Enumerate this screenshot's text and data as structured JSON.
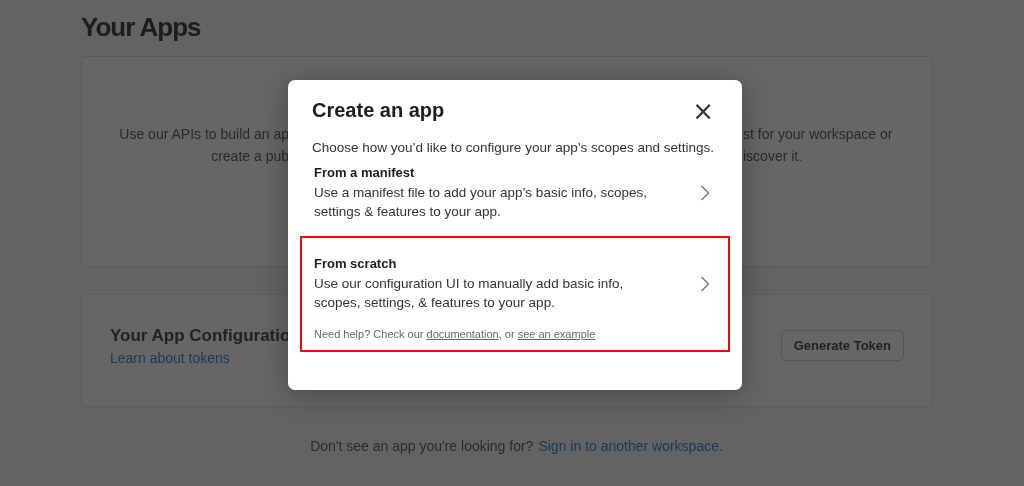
{
  "page": {
    "title": "Your Apps",
    "intro_card": {
      "left_lines": [
        "Use our APIs to build an ap",
        "create a pub"
      ],
      "right_lines": [
        "st for your workspace or",
        "iscover it."
      ]
    },
    "config_card": {
      "title": "Your App Configuratio",
      "link": "Learn about tokens",
      "button": "Generate Token"
    },
    "footer": {
      "text": "Don't see an app you're looking for?",
      "link": "Sign in to another workspace."
    }
  },
  "dialog": {
    "title": "Create an app",
    "close": "×",
    "subtitle": "Choose how you’d like to configure your app’s scopes and settings.",
    "options": [
      {
        "title": "From a manifest",
        "description": "Use a manifest file to add your app’s basic info, scopes, settings & features to your app.",
        "highlighted": false
      },
      {
        "title": "From scratch",
        "description": "Use our configuration UI to manually add basic info, scopes, settings, & features to your app.",
        "highlighted": true
      }
    ],
    "help": {
      "text": "Need help? Check our",
      "link1": "documentation",
      "between": ", or",
      "link2": "see an example"
    }
  }
}
